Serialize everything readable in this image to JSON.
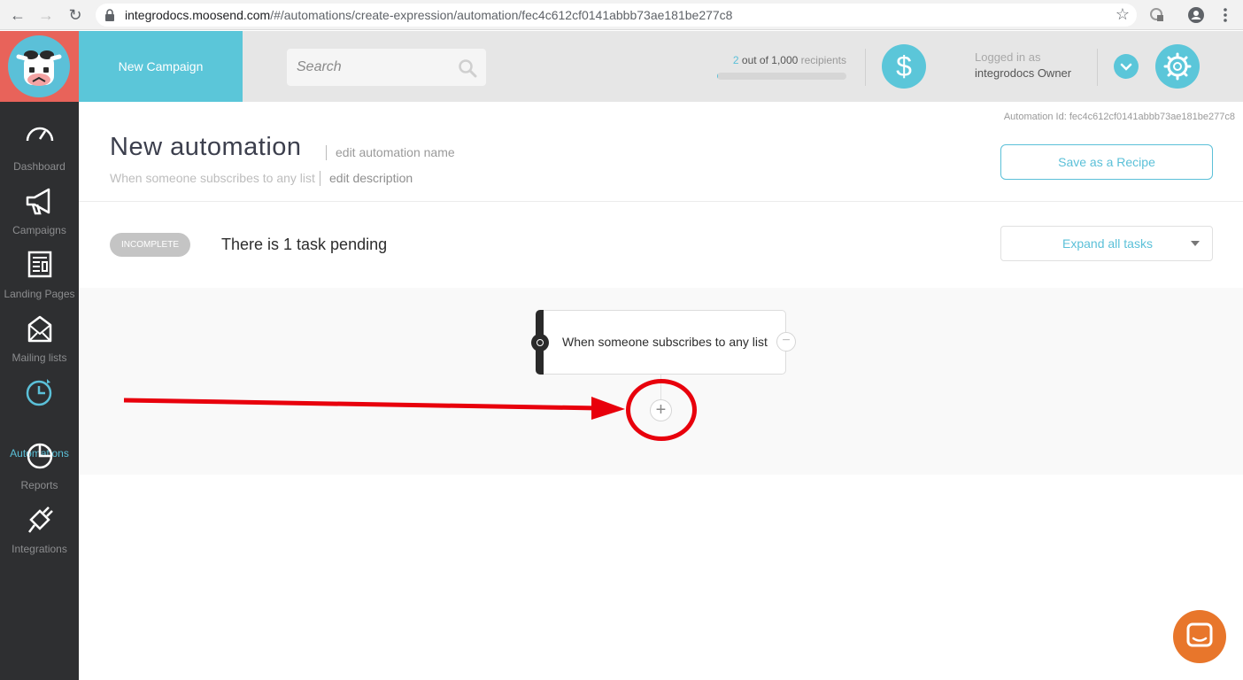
{
  "browser": {
    "url_host": "integrodocs.moosend.com",
    "url_path": "/#/automations/create-expression/automation/fec4c612cf0141abbb73ae181be277c8"
  },
  "sidebar": {
    "items": [
      {
        "label": "Dashboard"
      },
      {
        "label": "Campaigns"
      },
      {
        "label": "Landing Pages"
      },
      {
        "label": "Mailing lists"
      },
      {
        "label": "Automations"
      },
      {
        "label": "Reports"
      },
      {
        "label": "Integrations"
      }
    ],
    "active": "Automations"
  },
  "header": {
    "new_campaign": "New Campaign",
    "search_placeholder": "Search",
    "recipients_used": "2",
    "recipients_mid": "out of",
    "recipients_total": "1,000",
    "recipients_label": "recipients",
    "recipients_fraction": 0.002,
    "logged_in_as": "Logged in as",
    "user": "integrodocs Owner"
  },
  "automation": {
    "id_text": "Automation Id: fec4c612cf0141abbb73ae181be277c8",
    "title": "New automation",
    "edit_name": "edit automation name",
    "description": "When someone subscribes to any list",
    "edit_description": "edit description",
    "save_recipe": "Save as a Recipe",
    "status_badge": "INCOMPLETE",
    "pending_text": "There is 1 task pending",
    "expand_all": "Expand all tasks"
  },
  "workflow": {
    "trigger": "When someone subscribes to any list",
    "remove_symbol": "−",
    "add_symbol": "+"
  },
  "colors": {
    "accent": "#5bc6d9",
    "sidebar": "#2e2f31",
    "logo_bg": "#e8635a",
    "annotation": "#e8000c",
    "chat": "#e8762b"
  }
}
